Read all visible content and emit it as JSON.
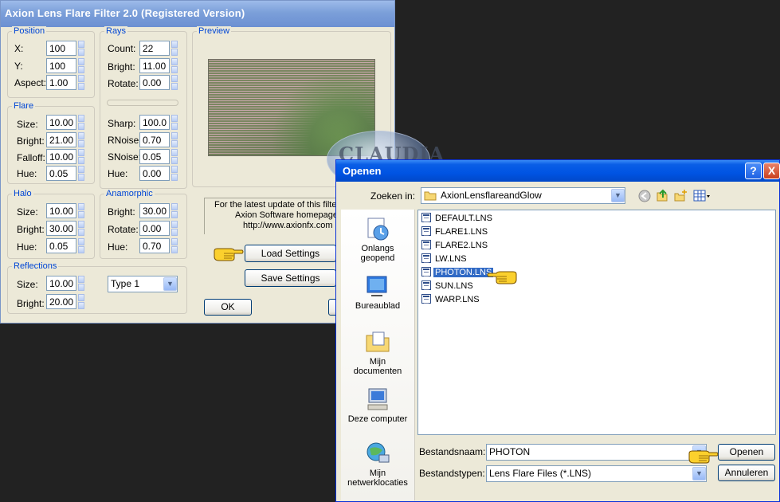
{
  "axion": {
    "title": "Axion Lens Flare Filter 2.0 (Registered Version)",
    "position": {
      "title": "Position",
      "x": {
        "label": "X:",
        "value": "100"
      },
      "y": {
        "label": "Y:",
        "value": "100"
      },
      "aspect": {
        "label": "Aspect:",
        "value": "1.00"
      }
    },
    "rays": {
      "title": "Rays",
      "count": {
        "label": "Count:",
        "value": "22"
      },
      "bright": {
        "label": "Bright:",
        "value": "11.00"
      },
      "rotate": {
        "label": "Rotate:",
        "value": "0.00"
      },
      "sharp": {
        "label": "Sharp:",
        "value": "100.0"
      },
      "rnoise": {
        "label": "RNoise:",
        "value": "0.70"
      },
      "snoise": {
        "label": "SNoise:",
        "value": "0.05"
      },
      "hue": {
        "label": "Hue:",
        "value": "0.00"
      }
    },
    "flare": {
      "title": "Flare",
      "size": {
        "label": "Size:",
        "value": "10.00"
      },
      "bright": {
        "label": "Bright:",
        "value": "21.00"
      },
      "falloff": {
        "label": "Falloff:",
        "value": "10.00"
      },
      "hue": {
        "label": "Hue:",
        "value": "0.05"
      }
    },
    "halo": {
      "title": "Halo",
      "size": {
        "label": "Size:",
        "value": "10.00"
      },
      "bright": {
        "label": "Bright:",
        "value": "30.00"
      },
      "hue": {
        "label": "Hue:",
        "value": "0.05"
      }
    },
    "anamorphic": {
      "title": "Anamorphic",
      "bright": {
        "label": "Bright:",
        "value": "30.00"
      },
      "rotate": {
        "label": "Rotate:",
        "value": "0.00"
      },
      "hue": {
        "label": "Hue:",
        "value": "0.70"
      }
    },
    "reflections": {
      "title": "Reflections",
      "size": {
        "label": "Size:",
        "value": "10.00"
      },
      "bright": {
        "label": "Bright:",
        "value": "20.00"
      },
      "type": "Type 1"
    },
    "preview_title": "Preview",
    "info_line1": "For the latest update of this filter,",
    "info_line2": "Axion Software homepage",
    "info_line3": "http://www.axionfx.com",
    "load_settings": "Load Settings",
    "save_settings": "Save Settings",
    "ok": "OK"
  },
  "open_dialog": {
    "title": "Openen",
    "look_in_label": "Zoeken in:",
    "look_in_value": "AxionLensflareandGlow",
    "places": [
      {
        "label_line1": "Onlangs",
        "label_line2": "geopend",
        "icon": "recent-documents-icon"
      },
      {
        "label_line1": "Bureaublad",
        "label_line2": "",
        "icon": "desktop-icon"
      },
      {
        "label_line1": "Mijn",
        "label_line2": "documenten",
        "icon": "my-documents-icon"
      },
      {
        "label_line1": "Deze computer",
        "label_line2": "",
        "icon": "my-computer-icon"
      },
      {
        "label_line1": "Mijn",
        "label_line2": "netwerklocaties",
        "icon": "network-places-icon"
      }
    ],
    "files": [
      "DEFAULT.LNS",
      "FLARE1.LNS",
      "FLARE2.LNS",
      "LW.LNS",
      "PHOTON.LNS",
      "SUN.LNS",
      "WARP.LNS"
    ],
    "selected_file": "PHOTON.LNS",
    "filename_label": "Bestandsnaam:",
    "filename_value": "PHOTON",
    "filetype_label": "Bestandstypen:",
    "filetype_value": "Lens Flare Files (*.LNS)",
    "open_button": "Openen",
    "cancel_button": "Annuleren",
    "help_button": "?",
    "close_button": "X"
  },
  "watermark": "CLAUDIA",
  "colors": {
    "xp_blue": "#0054e3",
    "selection": "#316ac5",
    "group_title": "#0046d5",
    "dialog_bg": "#ece9d8"
  }
}
